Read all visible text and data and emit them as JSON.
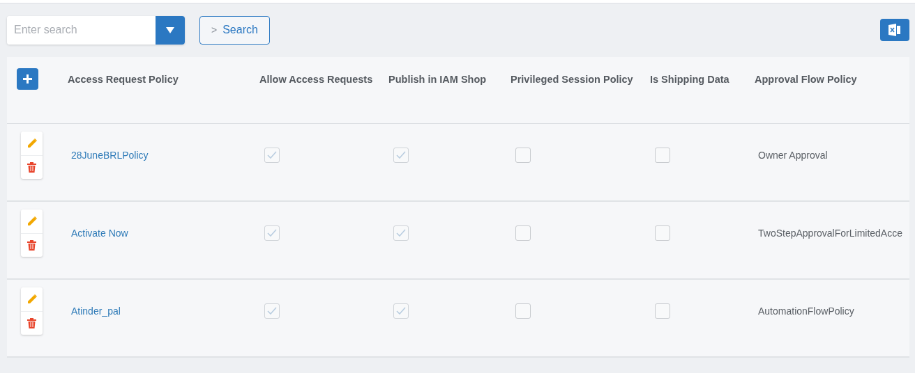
{
  "toolbar": {
    "search": {
      "placeholder": "Enter search"
    },
    "search_button": {
      "icon": ">",
      "label": "Search"
    }
  },
  "table": {
    "columns": [
      "Access Request Policy",
      "Allow Access Requests",
      "Publish in IAM Shop",
      "Privileged Session Policy",
      "Is Shipping Data",
      "Approval Flow Policy"
    ],
    "rows": [
      {
        "name": "28JuneBRLPolicy",
        "allow_access_requests": true,
        "publish_in_iam_shop": true,
        "privileged_session_policy": false,
        "is_shipping_data": false,
        "approval_flow_policy": "Owner Approval"
      },
      {
        "name": "Activate Now",
        "allow_access_requests": true,
        "publish_in_iam_shop": true,
        "privileged_session_policy": false,
        "is_shipping_data": false,
        "approval_flow_policy": "TwoStepApprovalForLimitedAcce"
      },
      {
        "name": "Atinder_pal",
        "allow_access_requests": true,
        "publish_in_iam_shop": true,
        "privileged_session_policy": false,
        "is_shipping_data": false,
        "approval_flow_policy": "AutomationFlowPolicy"
      }
    ]
  }
}
